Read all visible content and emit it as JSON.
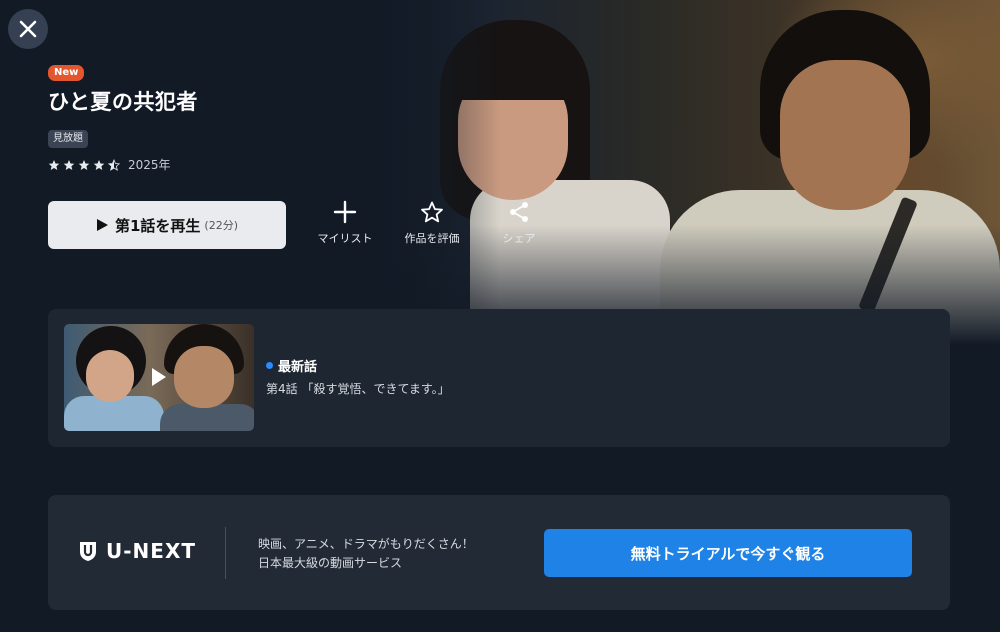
{
  "header": {
    "new_badge": "New",
    "title": "ひと夏の共犯者",
    "availability_badge": "見放題",
    "rating_stars": 4.5,
    "year": "2025年"
  },
  "actions": {
    "play_label": "第1話を再生",
    "play_duration": "(22分)",
    "mylist_label": "マイリスト",
    "rate_label": "作品を評価",
    "share_label": "シェア"
  },
  "latest_episode": {
    "label": "最新話",
    "title": "第4話 「殺す覚悟、できてます。」"
  },
  "promo": {
    "logo_text": "U-NEXT",
    "line1": "映画、アニメ、ドラマがもりだくさん！",
    "line2": "日本最大級の動画サービス",
    "cta_label": "無料トライアルで今すぐ観る"
  },
  "colors": {
    "background": "#121a26",
    "card": "#1e2632",
    "accent_blue": "#1e82e6",
    "new_badge": "#e4572e"
  },
  "icons": {
    "close": "close-icon",
    "play": "play-icon",
    "mylist": "plus-icon",
    "rate": "star-outline-icon",
    "share": "share-icon",
    "logo": "u-next-shield-icon"
  }
}
